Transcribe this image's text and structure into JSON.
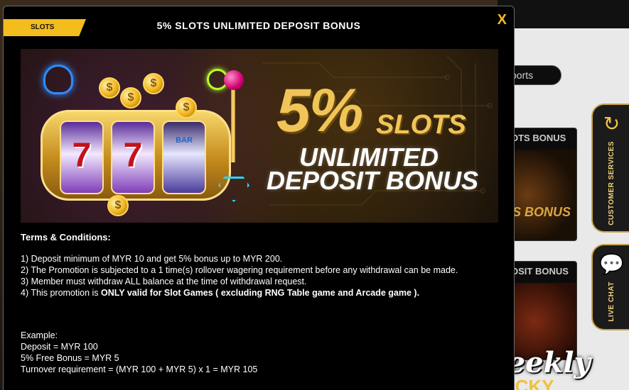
{
  "background": {
    "tab_fragment": "ports",
    "card1_header": "OTS BONUS",
    "card1_text": "S BONUS",
    "card2_header": "OSIT BONUS",
    "side_tabs": [
      {
        "label": "CUSTOMER SERVICES",
        "icon": "clock-24-icon"
      },
      {
        "label": "LIVE CHAT",
        "icon": "chat-bubble-icon"
      }
    ],
    "promo_fragment": "Weekly",
    "promo_fragment2": "LUCKY"
  },
  "modal": {
    "badge": "SLOTS",
    "title": "5% SLOTS UNLIMITED DEPOSIT BONUS",
    "close": "X",
    "banner": {
      "pct": "5%",
      "slots": "SLOTS",
      "line1": "UNLIMITED",
      "line2": "DEPOSIT BONUS",
      "reel_bar": "BAR",
      "reel_seven": "7",
      "coin_symbol": "$"
    },
    "terms_title": "Terms & Conditions:",
    "rules": [
      "1) Deposit minimum of MYR 10 and get 5% bonus up to MYR 200.",
      "2) The Promotion is subjected to a 1 time(s) rollover wagering requirement before any withdrawal can be made.",
      "3) Member must withdraw ALL balance at the time of withdrawal request.",
      "4) This promotion is "
    ],
    "rule4_bold": "ONLY valid for Slot Games ( excluding RNG Table game and Arcade game ).",
    "example": [
      "Example:",
      "Deposit = MYR 100",
      "5% Free Bonus = MYR 5",
      "Turnover requirement = (MYR 100 + MYR 5) x 1 = MYR 105"
    ]
  },
  "colors": {
    "accent": "#f3bd1d",
    "modal_bg": "#000000",
    "text": "#ffffff"
  }
}
